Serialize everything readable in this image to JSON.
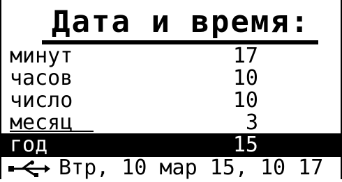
{
  "title": "Дата и время:",
  "menu": {
    "items": [
      {
        "label": "минут",
        "value": "17",
        "selected": false
      },
      {
        "label": "часов",
        "value": "10",
        "selected": false
      },
      {
        "label": "число",
        "value": "10",
        "selected": false
      },
      {
        "label": "месяц",
        "value": "3",
        "selected": false
      },
      {
        "label": "год",
        "value": "15",
        "selected": true
      }
    ]
  },
  "status": {
    "icon": "usb-icon",
    "text": "Втр, 10 мар 15, 10 17"
  }
}
